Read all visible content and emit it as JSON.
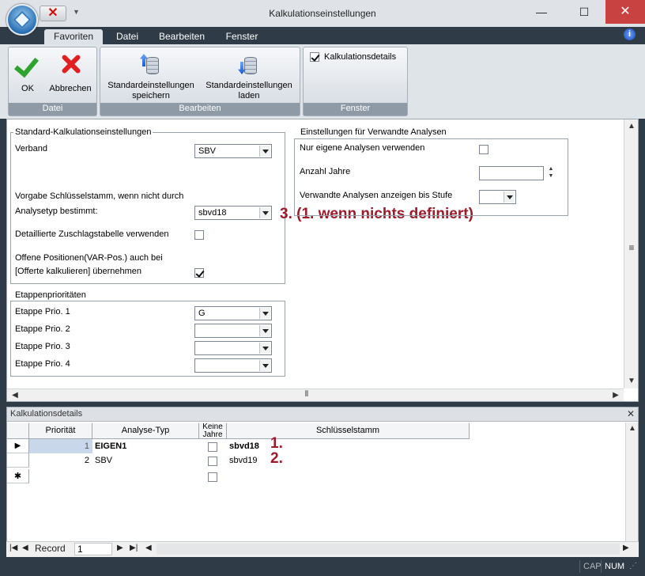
{
  "window": {
    "title": "Kalkulationseinstellungen"
  },
  "ribbon": {
    "tabs": [
      "Favoriten",
      "Datei",
      "Bearbeiten",
      "Fenster"
    ],
    "groups": {
      "datei": {
        "label": "Datei",
        "ok": "OK",
        "cancel": "Abbrechen"
      },
      "bearbeiten": {
        "label": "Bearbeiten",
        "save_line1": "Standardeinstellungen",
        "save_line2": "speichern",
        "load_line1": "Standardeinstellungen",
        "load_line2": "laden"
      },
      "fenster": {
        "label": "Fenster",
        "checkbox_label": "Kalkulationsdetails",
        "checkbox_checked": true
      }
    }
  },
  "standard": {
    "legend": "Standard-Kalkulationseinstellungen",
    "verband_label": "Verband",
    "verband_value": "SBV",
    "vorgabe_line1": "Vorgabe Schlüsselstamm, wenn nicht durch",
    "vorgabe_line2": "Analysetyp bestimmt:",
    "vorgabe_value": "sbvd18",
    "zuschlag_label": "Detaillierte Zuschlagstabelle verwenden",
    "offene_line1": "Offene Positionen(VAR-Pos.) auch bei",
    "offene_line2": "[Offerte kalkulieren] übernehmen"
  },
  "annotation_main": "3. (1. wenn nichts definiert)",
  "etappen": {
    "legend": "Etappenprioritäten",
    "rows": [
      {
        "label": "Etappe Prio. 1",
        "value": "G"
      },
      {
        "label": "Etappe Prio. 2",
        "value": ""
      },
      {
        "label": "Etappe Prio. 3",
        "value": ""
      },
      {
        "label": "Etappe Prio. 4",
        "value": ""
      }
    ]
  },
  "verwandte": {
    "legend": "Einstellungen für Verwandte Analysen",
    "nur_eigene": "Nur eigene Analysen verwenden",
    "anzahl_jahre": "Anzahl Jahre",
    "anzeigen_bis": "Verwandte Analysen anzeigen bis Stufe"
  },
  "details": {
    "title": "Kalkulationsdetails",
    "columns": [
      "Priorität",
      "Analyse-Typ",
      "Keine Jahre",
      "Schlüsselstamm"
    ],
    "rows": [
      {
        "prio": "1",
        "typ": "EIGEN1",
        "stamm": "sbvd18",
        "annot": "1."
      },
      {
        "prio": "2",
        "typ": "SBV",
        "stamm": "sbvd19",
        "annot": "2."
      }
    ],
    "new_row_marker": "✱"
  },
  "navigator": {
    "label": "Record",
    "value": "1"
  },
  "status": {
    "cap": "CAP",
    "num": "NUM"
  }
}
